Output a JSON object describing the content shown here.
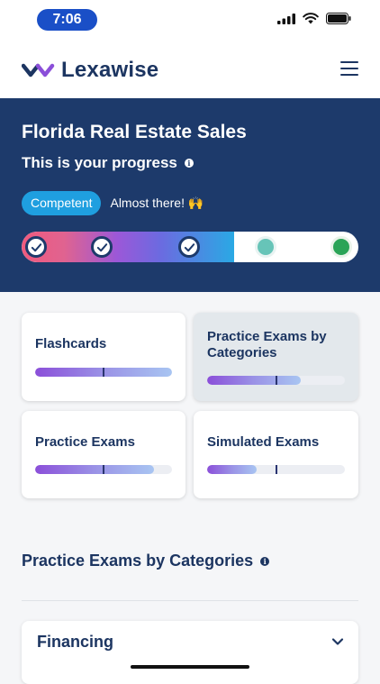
{
  "status_bar": {
    "time": "7:06"
  },
  "header": {
    "logo_text": "Lexawise"
  },
  "hero": {
    "title": "Florida Real Estate Sales",
    "subtitle": "This is your progress",
    "badge": "Competent",
    "badge_note": "Almost there! 🙌",
    "progress_fraction": 0.63,
    "milestones": [
      {
        "state": "done"
      },
      {
        "state": "done"
      },
      {
        "state": "done"
      },
      {
        "state": "upcoming"
      },
      {
        "state": "goal"
      }
    ]
  },
  "cards": [
    {
      "title": "Flashcards",
      "progress": 1.0,
      "marker": 0.5,
      "active": false
    },
    {
      "title": "Practice Exams by Categories",
      "progress": 0.68,
      "marker": 0.5,
      "active": true
    },
    {
      "title": "Practice Exams",
      "progress": 0.87,
      "marker": 0.5,
      "active": false
    },
    {
      "title": "Simulated Exams",
      "progress": 0.36,
      "marker": 0.5,
      "active": false
    }
  ],
  "section": {
    "title": "Practice Exams by Categories"
  },
  "accordion": [
    {
      "title": "Financing"
    }
  ],
  "colors": {
    "brand_navy": "#1d3a6b",
    "badge_blue": "#1f9fe0",
    "accent_purple": "#8b4fd9",
    "goal_green": "#2aa457",
    "milestone_teal": "#67c4b8"
  }
}
